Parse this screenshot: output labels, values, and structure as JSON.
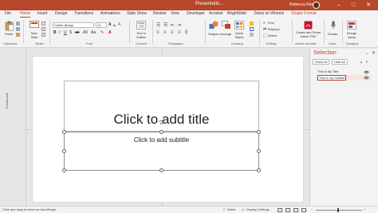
{
  "titlebar": {
    "doc_title": "Presentatio...",
    "user": "Rebecca Renner",
    "minimize": "–",
    "maximize": "□",
    "close": "✕"
  },
  "tabs": [
    "File",
    "Home",
    "Insert",
    "Design",
    "Transitions",
    "Animations",
    "Slide Show",
    "Review",
    "View",
    "Developer",
    "Acrobat",
    "BrightSlide",
    "Zebra on Wheels",
    "Shape Format"
  ],
  "ribbon": {
    "paste": "Paste",
    "new_slide": "New Slide",
    "font_name": "Calibri (Body)",
    "font_size": "12",
    "text_to_outline": "Text to Outline",
    "shapes": "Shapes",
    "arrange": "Arrange",
    "quick_styles": "Quick Styles",
    "find": "Find",
    "replace": "Replace",
    "select": "Select",
    "create_share_pdf": "Create and Share Adobe PDF",
    "dictate": "Dictate",
    "design_ideas": "Design Ideas",
    "groups": {
      "clipboard": "Clipboard",
      "slides": "Slides",
      "font": "Font",
      "convert": "Convert",
      "paragraph": "Paragraph",
      "drawing": "Drawing",
      "editing": "Editing",
      "adobe_acrobat": "Adobe Acrobat",
      "voice": "Voice",
      "designer": "Designer"
    }
  },
  "thumbnails_label": "Thumbnails",
  "slide": {
    "title_placeholder": "Click to add title",
    "subtitle_placeholder": "Click to add subtitle"
  },
  "selection_pane": {
    "title": "Selection",
    "show_all": "Show All",
    "hide_all": "Hide All",
    "items": [
      {
        "label": "This is My Title"
      },
      {
        "label": "This is my Subtitle"
      }
    ]
  },
  "status": {
    "hint": "Click and drag to insert an AutoShape.",
    "notes": "Notes",
    "display_settings": "Display Settings"
  },
  "colors": {
    "accent": "#b7472a",
    "ribbon_bg": "#f3f3f3",
    "canvas_bg": "#e6e6e6"
  },
  "icons": [
    "paste-icon",
    "new-slide-icon",
    "text-to-outline-icon",
    "shapes-icon",
    "arrange-icon",
    "quick-styles-icon",
    "find-icon",
    "replace-icon",
    "select-icon",
    "pdf-icon",
    "microphone-icon",
    "design-ideas-icon",
    "eye-icon",
    "rotate-handle-icon"
  ]
}
